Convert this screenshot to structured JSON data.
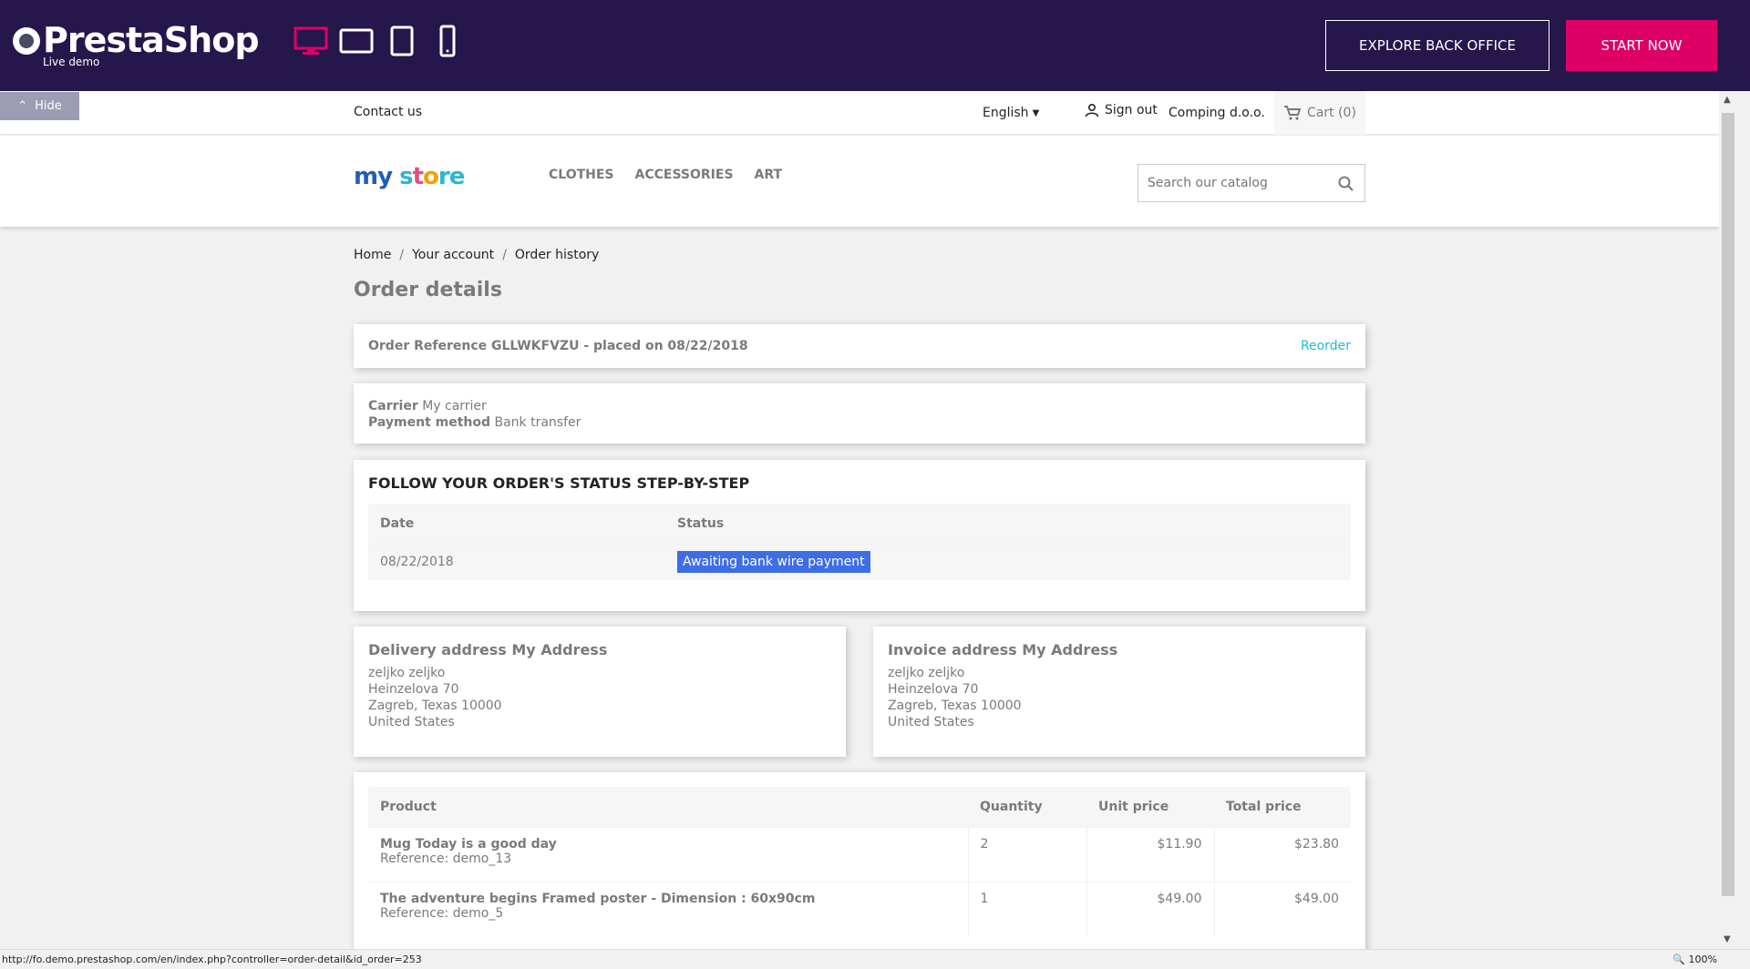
{
  "topbar": {
    "brand": "PrestaShop",
    "sub": "Live demo",
    "explore": "EXPLORE BACK OFFICE",
    "start": "START NOW",
    "devices": [
      "desktop-icon",
      "tablet-landscape-icon",
      "tablet-icon",
      "mobile-icon"
    ],
    "accent": "#df0067"
  },
  "hide": "Hide",
  "nav": {
    "contact": "Contact us",
    "language": "English",
    "signout": "Sign out",
    "company": "Comping d.o.o.",
    "cart": "Cart (0)"
  },
  "header": {
    "logo": "my store",
    "menu": [
      "CLOTHES",
      "ACCESSORIES",
      "ART"
    ],
    "search_placeholder": "Search our catalog"
  },
  "breadcrumb": [
    "Home",
    "Your account",
    "Order history"
  ],
  "title": "Order details",
  "order": {
    "ref": "Order Reference GLLWKFVZU - placed on 08/22/2018",
    "reorder": "Reorder",
    "carrier_label": "Carrier",
    "carrier": "My carrier",
    "payment_label": "Payment method",
    "payment": "Bank transfer"
  },
  "follow": {
    "heading": "FOLLOW YOUR ORDER'S STATUS STEP-BY-STEP",
    "headers": [
      "Date",
      "Status"
    ],
    "rows": [
      {
        "date": "08/22/2018",
        "status": "Awaiting bank wire payment"
      }
    ]
  },
  "delivery": {
    "heading": "Delivery address My Address",
    "lines": [
      "zeljko zeljko",
      "Heinzelova 70",
      "Zagreb, Texas 10000",
      "United States"
    ]
  },
  "invoice": {
    "heading": "Invoice address My Address",
    "lines": [
      "zeljko zeljko",
      "Heinzelova 70",
      "Zagreb, Texas 10000",
      "United States"
    ]
  },
  "products": {
    "headers": [
      "Product",
      "Quantity",
      "Unit price",
      "Total price"
    ],
    "rows": [
      {
        "name": "Mug Today is a good day",
        "ref": "Reference: demo_13",
        "qty": "2",
        "unit": "$11.90",
        "total": "$23.80"
      },
      {
        "name": "The adventure begins Framed poster - Dimension : 60x90cm",
        "ref": "Reference: demo_5",
        "qty": "1",
        "unit": "$49.00",
        "total": "$49.00"
      }
    ]
  },
  "status": {
    "url": "http://fo.demo.prestashop.com/en/index.php?controller=order-detail&id_order=253",
    "zoom": "100%"
  }
}
